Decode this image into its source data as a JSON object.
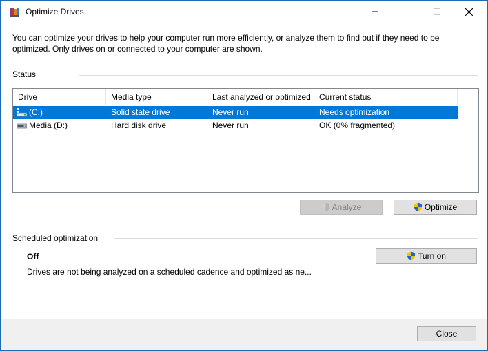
{
  "window": {
    "title": "Optimize Drives",
    "app_icon": "optimize-drives-icon",
    "controls": {
      "minimize": "minimize-icon",
      "maximize": "maximize-icon",
      "close": "close-icon"
    }
  },
  "description": "You can optimize your drives to help your computer run more efficiently, or analyze them to find out if they need to be optimized. Only drives on or connected to your computer are shown.",
  "status": {
    "label": "Status",
    "columns": [
      "Drive",
      "Media type",
      "Last analyzed or optimized",
      "Current status"
    ],
    "rows": [
      {
        "drive": "(C:)",
        "media_type": "Solid state drive",
        "last_analyzed": "Never run",
        "current_status": "Needs optimization",
        "icon": "system-drive-icon",
        "selected": true
      },
      {
        "drive": "Media (D:)",
        "media_type": "Hard disk drive",
        "last_analyzed": "Never run",
        "current_status": "OK (0% fragmented)",
        "icon": "hard-drive-icon",
        "selected": false
      }
    ],
    "analyze_label": "Analyze",
    "optimize_label": "Optimize"
  },
  "scheduled": {
    "label": "Scheduled optimization",
    "state": "Off",
    "description": "Drives are not being analyzed on a scheduled cadence and optimized as ne...",
    "turn_on_label": "Turn on"
  },
  "footer": {
    "close_label": "Close"
  },
  "colors": {
    "selection": "#0078d7",
    "window_border": "#1c6bb3",
    "footer_bg": "#f0f0f0",
    "button_bg": "#e1e1e1"
  }
}
